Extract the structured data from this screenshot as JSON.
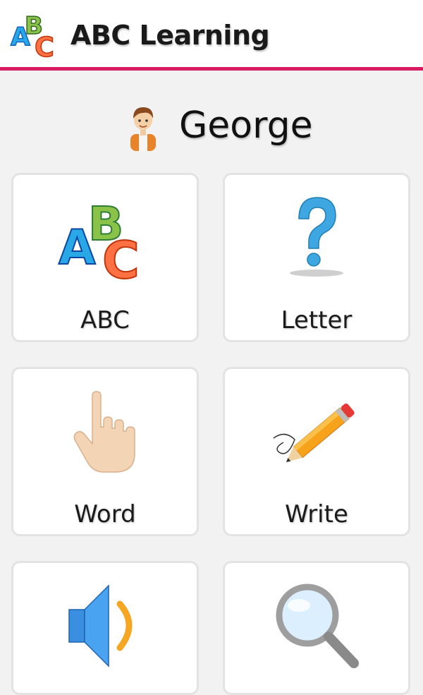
{
  "app": {
    "title": "ABC Learning",
    "logo_icon": "abc-blocks-icon",
    "accent_color": "#d81b60"
  },
  "profile": {
    "name": "George",
    "avatar_icon": "boy-avatar-icon"
  },
  "menu": [
    {
      "label": "ABC",
      "icon": "abc-blocks-icon"
    },
    {
      "label": "Letter",
      "icon": "question-mark-icon"
    },
    {
      "label": "Word",
      "icon": "pointing-hand-icon"
    },
    {
      "label": "Write",
      "icon": "pencil-icon"
    },
    {
      "label": "",
      "icon": "speaker-icon"
    },
    {
      "label": "",
      "icon": "magnifier-icon"
    }
  ]
}
